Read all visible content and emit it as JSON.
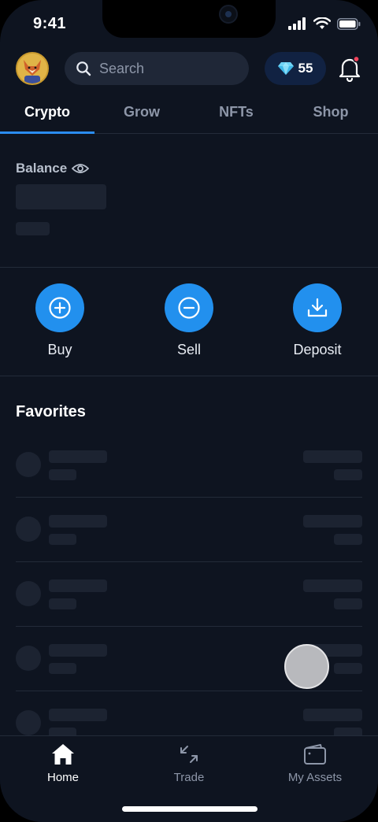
{
  "status_bar": {
    "time": "9:41"
  },
  "header": {
    "search_placeholder": "Search",
    "gems_count": "55"
  },
  "tabs": [
    {
      "label": "Crypto",
      "active": true
    },
    {
      "label": "Grow",
      "active": false
    },
    {
      "label": "NFTs",
      "active": false
    },
    {
      "label": "Shop",
      "active": false
    }
  ],
  "balance": {
    "label": "Balance"
  },
  "actions": [
    {
      "label": "Buy",
      "icon": "plus-circle-icon"
    },
    {
      "label": "Sell",
      "icon": "minus-circle-icon"
    },
    {
      "label": "Deposit",
      "icon": "download-icon"
    }
  ],
  "favorites": {
    "title": "Favorites"
  },
  "bottom_nav": [
    {
      "label": "Home",
      "icon": "home-icon",
      "active": true
    },
    {
      "label": "Trade",
      "icon": "trade-arrows-icon",
      "active": false
    },
    {
      "label": "My Assets",
      "icon": "wallet-icon",
      "active": false
    }
  ],
  "colors": {
    "background": "#0e1420",
    "accent": "#2290ee",
    "skeleton": "#1c2331",
    "divider": "#232b39"
  }
}
